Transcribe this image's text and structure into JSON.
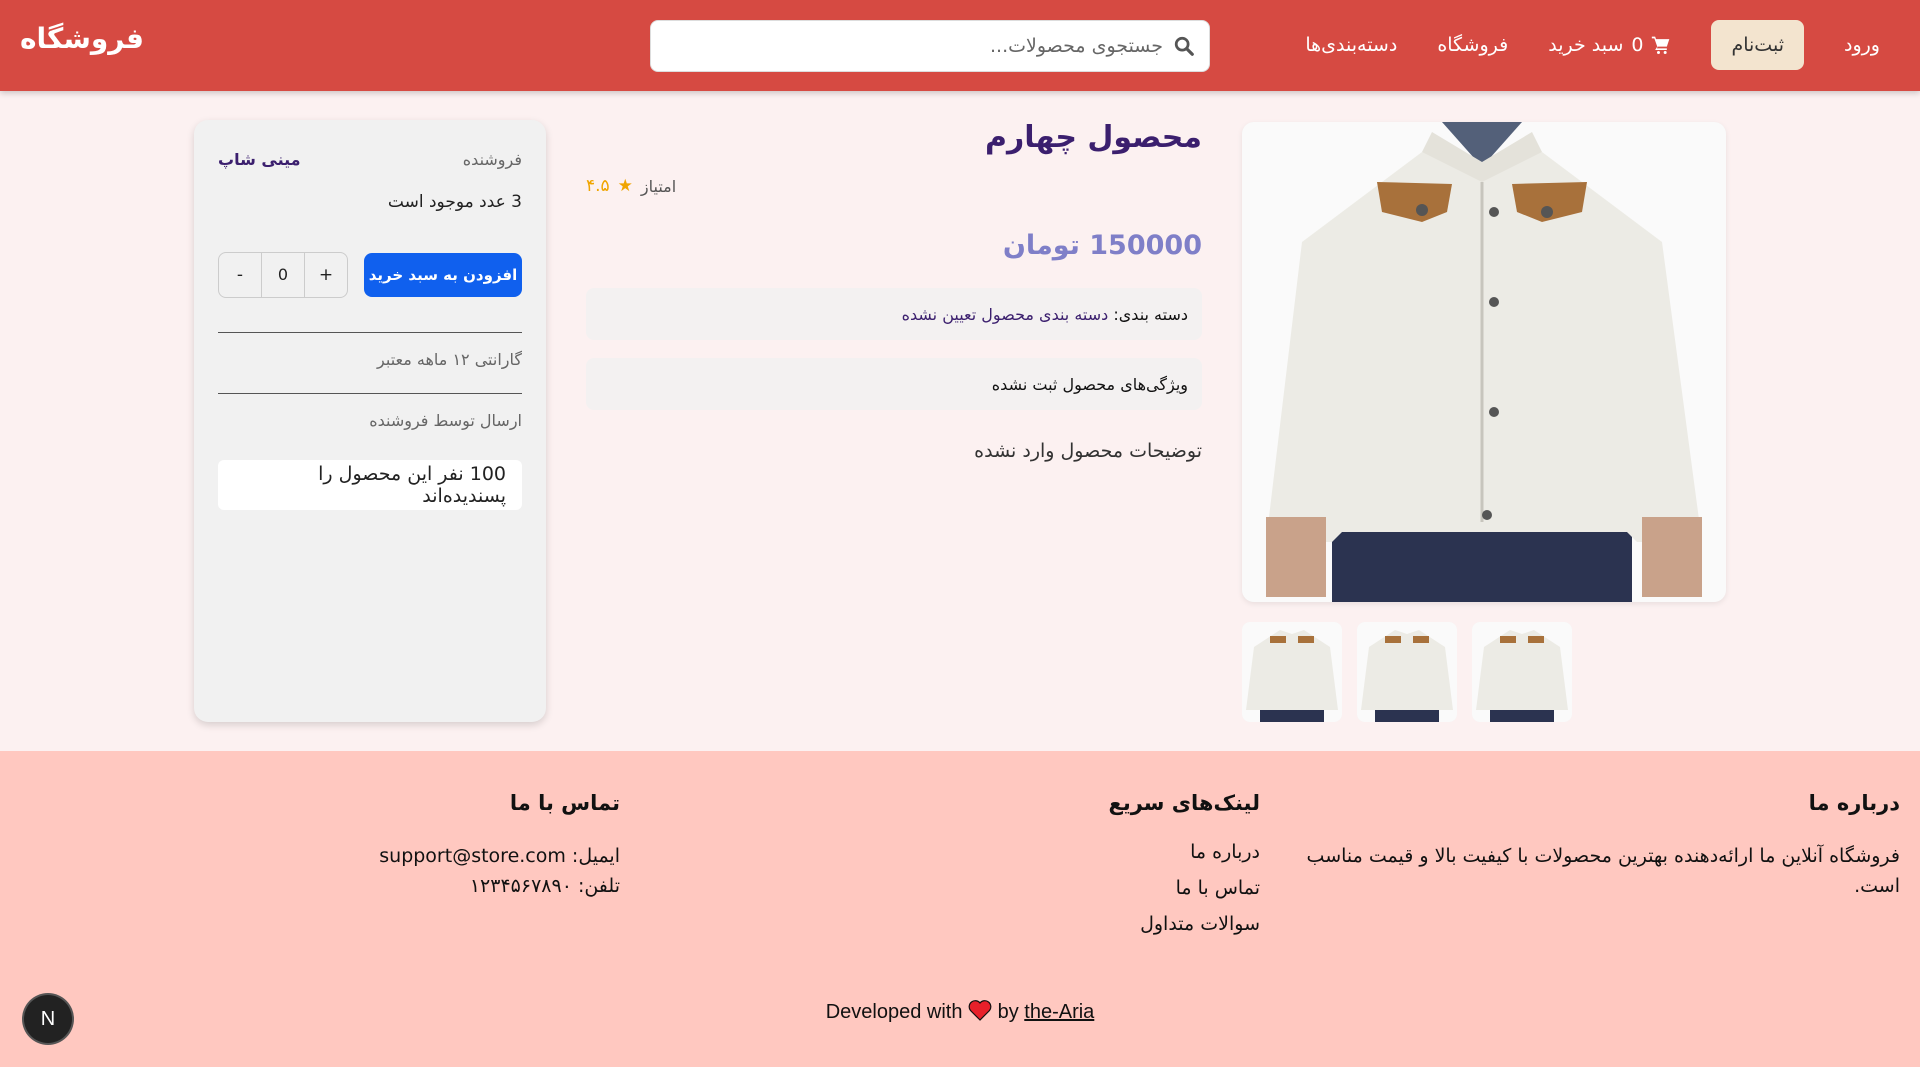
{
  "nav": {
    "login": "ورود",
    "signup": "ثبت‌نام",
    "cart_label": "سبد خرید",
    "cart_count": "0",
    "shop": "فروشگاه",
    "categories": "دسته‌بندی‌ها",
    "brand": "فروشگاه"
  },
  "search": {
    "placeholder": "جستجوی محصولات...",
    "value": ""
  },
  "product": {
    "title": "محصول چهارم",
    "rating_label": "امتیاز",
    "rating": "۴.۵",
    "price": "150000 تومان",
    "category_label": "دسته بندی:",
    "category_value": "دسته بندی محصول تعیین نشده",
    "features": "ویژگی‌های محصول ثبت نشده",
    "description": "توضیحات محصول وارد نشده"
  },
  "seller_card": {
    "seller_label": "فروشنده",
    "seller_name": "مینی شاپ",
    "stock": "3 عدد موجود است",
    "add_to_cart": "افزودن به سبد خرید",
    "qty_plus": "+",
    "qty_value": "0",
    "qty_minus": "-",
    "warranty": "گارانتی ۱۲ ماهه معتبر",
    "shipping": "ارسال توسط فروشنده",
    "likes": "100 نفر این محصول را پسندیده‌اند"
  },
  "footer": {
    "about_title": "درباره ما",
    "about_text": "فروشگاه آنلاین ما ارائه‌دهنده بهترین محصولات با کیفیت بالا و قیمت مناسب است.",
    "links_title": "لینک‌های سریع",
    "links": [
      "درباره ما",
      "تماس با ما",
      "سوالات متداول"
    ],
    "contact_title": "تماس با ما",
    "email": "ایمیل: support@store.com",
    "phone": "تلفن: ۱۲۳۴۵۶۷۸۹۰",
    "credit_prefix": "Developed with",
    "credit_by": "by",
    "credit_author": "the-Aria"
  },
  "dev_badge": "N",
  "colors": {
    "navbar": "#d64a42",
    "footer": "#ffc8c0",
    "primary_button": "#1060ee",
    "title": "#3b1f6e",
    "price": "#7f7fc8",
    "star": "#f0a500"
  }
}
